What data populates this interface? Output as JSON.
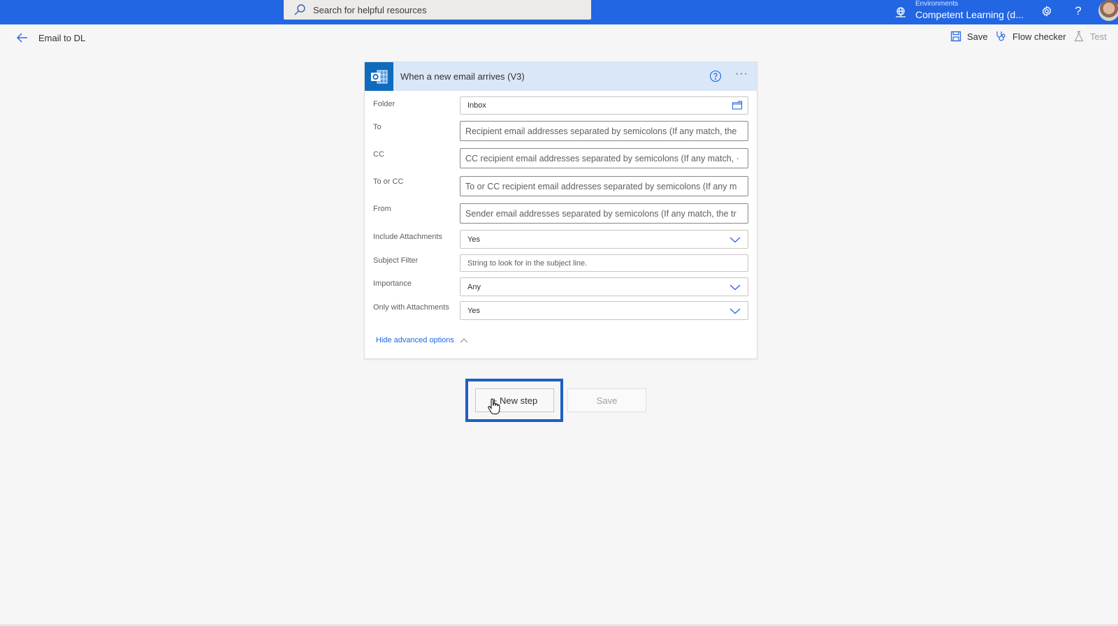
{
  "topbar": {
    "search_placeholder": "Search for helpful resources",
    "environment_label": "Environments",
    "environment_value": "Competent Learning (d...",
    "settings_icon": "gear-icon",
    "help_icon": "question-icon",
    "brand_color": "#2266e3"
  },
  "commandbar": {
    "flow_name": "Email to DL",
    "save_label": "Save",
    "flow_checker_label": "Flow checker",
    "test_label": "Test"
  },
  "trigger_card": {
    "title": "When a new email arrives (V3)",
    "header_color": "#d9e7f8",
    "fields": [
      {
        "label": "Folder",
        "value": "Inbox",
        "type": "folder-picker"
      },
      {
        "label": "To",
        "placeholder": "Recipient email addresses separated by semicolons (If any match, the",
        "type": "text"
      },
      {
        "label": "CC",
        "placeholder": "CC recipient email addresses separated by semicolons (If any match, ·",
        "type": "text"
      },
      {
        "label": "To or CC",
        "placeholder": "To or CC recipient email addresses separated by semicolons (If any m",
        "type": "text"
      },
      {
        "label": "From",
        "placeholder": "Sender email addresses separated by semicolons (If any match, the tr",
        "type": "text"
      },
      {
        "label": "Include Attachments",
        "value": "Yes",
        "type": "dropdown"
      },
      {
        "label": "Subject Filter",
        "placeholder": "String to look for in the subject line.",
        "type": "text"
      },
      {
        "label": "Importance",
        "value": "Any",
        "type": "dropdown"
      },
      {
        "label": "Only with Attachments",
        "value": "Yes",
        "type": "dropdown"
      }
    ],
    "advanced_toggle": "Hide advanced options"
  },
  "actions": {
    "new_step_label": "+ New step",
    "save_label": "Save"
  }
}
